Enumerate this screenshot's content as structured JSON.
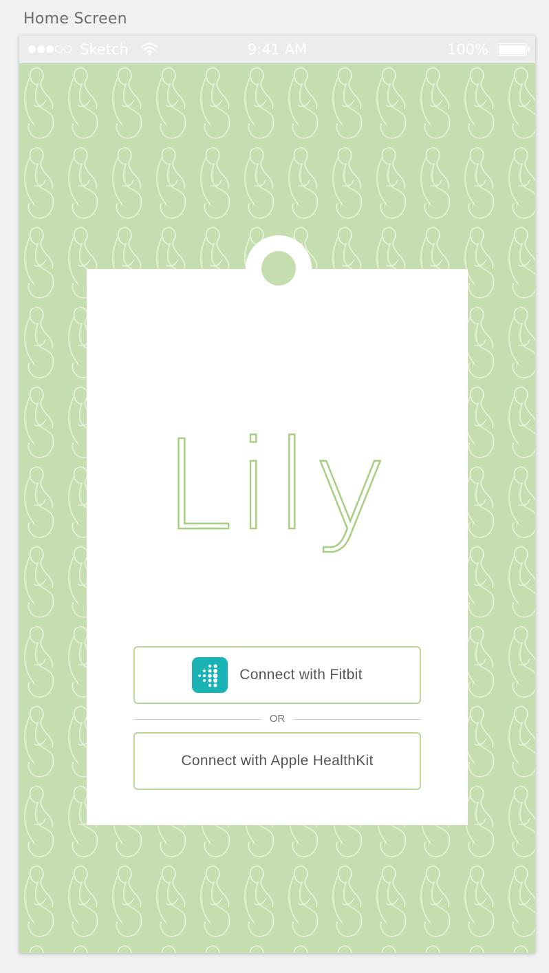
{
  "artboard": {
    "label": "Home Screen"
  },
  "status_bar": {
    "signal_icon": "signal-dots-icon",
    "signal_bars_filled": 3,
    "signal_bars_total": 5,
    "carrier": "Sketch",
    "wifi_icon": "wifi-icon",
    "time": "9:41 AM",
    "battery_percent": "100%",
    "battery_icon": "battery-icon",
    "battery_level": 1.0
  },
  "app": {
    "logo_text": "Lily",
    "background_pattern_icon": "pregnant-woman-silhouette-pattern"
  },
  "actions": {
    "fitbit_label": "Connect with Fitbit",
    "fitbit_icon": "fitbit-logo-icon",
    "or_label": "OR",
    "healthkit_label": "Connect with Apple HealthKit"
  },
  "colors": {
    "background_green": "#c5deaf",
    "accent_green": "#a7cf82",
    "button_border": "#b7d69a",
    "fitbit_teal": "#19b3b6",
    "status_bar": "#ececec"
  }
}
